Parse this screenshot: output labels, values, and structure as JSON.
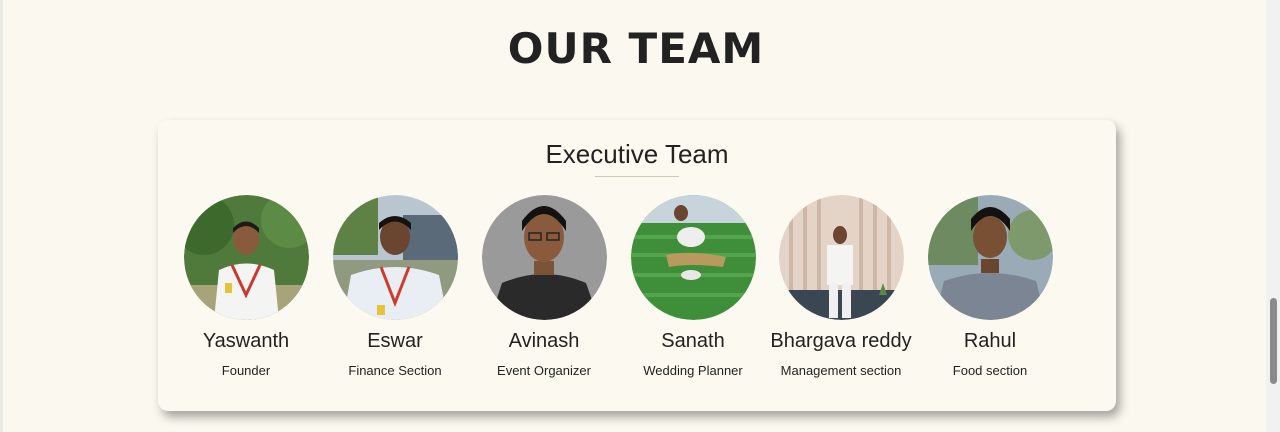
{
  "page": {
    "title": "OUR TEAM"
  },
  "team": {
    "title": "Executive Team",
    "members": [
      {
        "name": "Yaswanth",
        "role": "Founder",
        "photo": "yaswanth-photo"
      },
      {
        "name": "Eswar",
        "role": "Finance Section",
        "photo": "eswar-photo"
      },
      {
        "name": "Avinash",
        "role": "Event Organizer",
        "photo": "avinash-photo"
      },
      {
        "name": "Sanath",
        "role": "Wedding Planner",
        "photo": "sanath-photo"
      },
      {
        "name": "Bhargava reddy",
        "role": "Management section",
        "photo": "bhargava-photo"
      },
      {
        "name": "Rahul",
        "role": "Food section",
        "photo": "rahul-photo"
      }
    ]
  }
}
